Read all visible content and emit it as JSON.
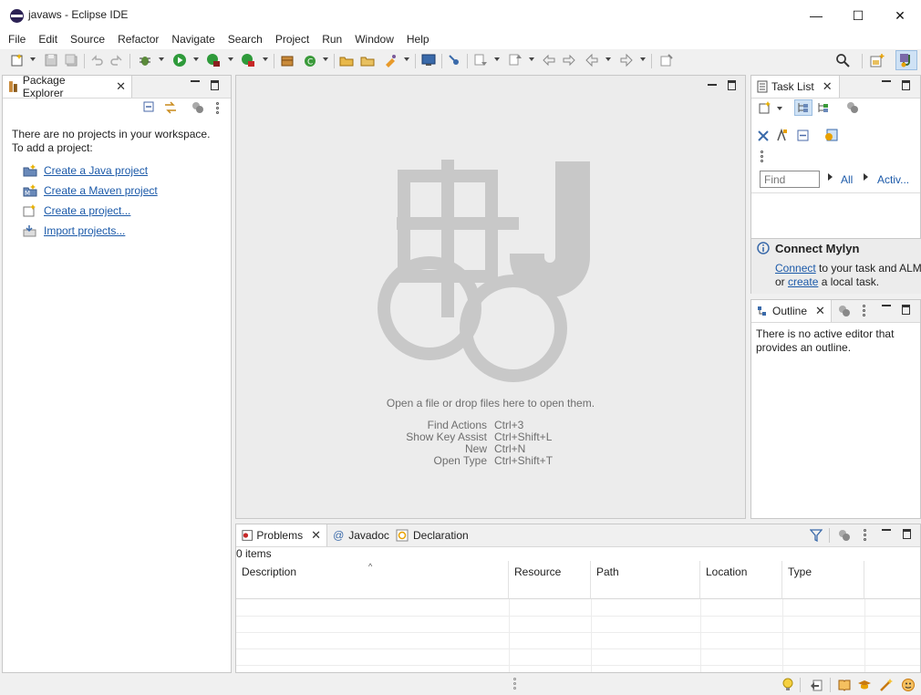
{
  "window": {
    "title": "javaws - Eclipse IDE",
    "minimize": "—",
    "maximize": "☐",
    "close": "✕"
  },
  "menu": [
    "File",
    "Edit",
    "Source",
    "Refactor",
    "Navigate",
    "Search",
    "Project",
    "Run",
    "Window",
    "Help"
  ],
  "package_explorer": {
    "tab_label": "Package Explorer",
    "message_line1": "There are no projects in your workspace.",
    "message_line2": "To add a project:",
    "links": [
      "Create a Java project",
      "Create a Maven project",
      "Create a project...",
      "Import projects..."
    ]
  },
  "editor": {
    "drop_message": "Open a file or drop files here to open them.",
    "shortcuts": [
      {
        "action": "Find Actions",
        "key": "Ctrl+3"
      },
      {
        "action": "Show Key Assist",
        "key": "Ctrl+Shift+L"
      },
      {
        "action": "New",
        "key": "Ctrl+N"
      },
      {
        "action": "Open Type",
        "key": "Ctrl+Shift+T"
      }
    ]
  },
  "task_list": {
    "tab_label": "Task List",
    "find_placeholder": "Find",
    "filter_all": "All",
    "filter_activate": "Activ..."
  },
  "mylyn": {
    "title": "Connect Mylyn",
    "connect_link": "Connect",
    "text1": " to your task and ALM",
    "or": "or ",
    "create_link": "create",
    "text2": " a local task."
  },
  "outline": {
    "tab_label": "Outline",
    "message_line1": "There is no active editor that",
    "message_line2": "provides an outline."
  },
  "bottom": {
    "tabs": [
      "Problems",
      "Javadoc",
      "Declaration"
    ],
    "item_count": "0 items",
    "columns": [
      "Description",
      "Resource",
      "Path",
      "Location",
      "Type"
    ]
  },
  "colors": {
    "link": "#1c5aa9",
    "watermark": "#c8c8c8",
    "accent": "#2c2255"
  }
}
